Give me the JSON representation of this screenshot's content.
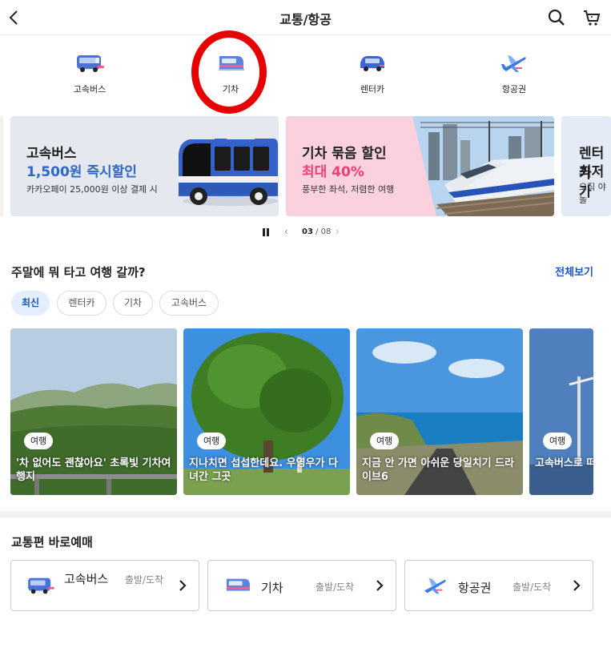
{
  "header": {
    "title": "교통/항공"
  },
  "categories": [
    {
      "label": "고속버스",
      "icon": "bus-icon"
    },
    {
      "label": "기차",
      "icon": "train-icon"
    },
    {
      "label": "렌터카",
      "icon": "rental-car-icon"
    },
    {
      "label": "항공권",
      "icon": "airplane-icon"
    }
  ],
  "banners": [
    {
      "title": "고속버스",
      "highlight": "1,500원 즉시할인",
      "desc": "카카오페이 25,000원 이상 결제 시",
      "highlight_color": "#2e66c9"
    },
    {
      "title": "기차 묶음 할인",
      "highlight": "최대 40%",
      "desc": "풍부한 좌석, 저렴한 여행",
      "highlight_color": "#ea3f7a"
    },
    {
      "title": "렌터카",
      "highlight": "최저가",
      "desc": "오직 야놀"
    }
  ],
  "pager": {
    "current": "03",
    "separator": " / ",
    "total": "08"
  },
  "weekend": {
    "title": "주말에 뭐 타고 여행 갈까?",
    "see_all": "전체보기",
    "chips": [
      "최신",
      "렌터카",
      "기차",
      "고속버스"
    ],
    "cards": [
      {
        "tag": "여행",
        "title": "'차 없어도 괜찮아요' 초록빛 기차여행지"
      },
      {
        "tag": "여행",
        "title": "지나치면 섭섭한데요. 우영우가 다녀간 그곳"
      },
      {
        "tag": "여행",
        "title": "지금 안 가면 아쉬운 당일치기 드라이브6"
      },
      {
        "tag": "여행",
        "title": "고속버스로 떠나는 여름 여행지"
      }
    ]
  },
  "quick_booking": {
    "title": "교통편 바로예매",
    "items": [
      {
        "name": "고속버스",
        "sub": "출발/도착",
        "icon": "bus-icon"
      },
      {
        "name": "기차",
        "sub": "출발/도착",
        "icon": "train-icon"
      },
      {
        "name": "항공권",
        "sub": "출발/도착",
        "icon": "airplane-icon"
      }
    ]
  },
  "colors": {
    "accent": "#1a56c4",
    "highlight_circle": "#e60000"
  }
}
